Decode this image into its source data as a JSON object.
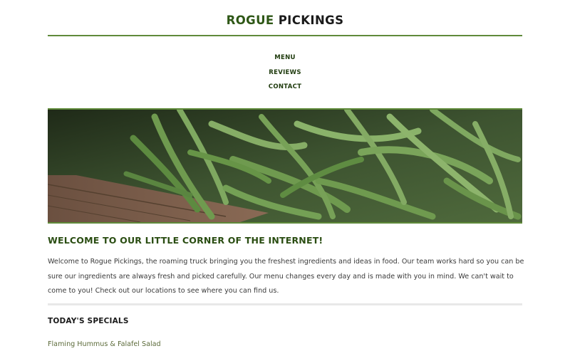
{
  "header": {
    "title_accent": "ROGUE",
    "title_rest": " PICKINGS"
  },
  "nav": {
    "items": [
      "MENU",
      "REVIEWS",
      "CONTACT"
    ]
  },
  "hero": {
    "image_icon": "green-beans-photo"
  },
  "welcome": {
    "heading": "WELCOME TO OUR LITTLE CORNER OF THE INTERNET!",
    "body": "Welcome to Rogue Pickings, the roaming truck bringing you the freshest ingredients and ideas in food. Our team works hard so you can be sure our ingredients are always fresh and picked carefully. Our menu changes every day and is made with you in mind. We can't wait to come to you! Check out our locations to see where you can find us."
  },
  "specials": {
    "heading": "TODAY'S SPECIALS",
    "items": [
      "Flaming Hummus & Falafel Salad"
    ]
  },
  "colors": {
    "accent_green": "#2e5716",
    "rule_green": "#5f8a3a",
    "special_text": "#5c6b3a"
  }
}
